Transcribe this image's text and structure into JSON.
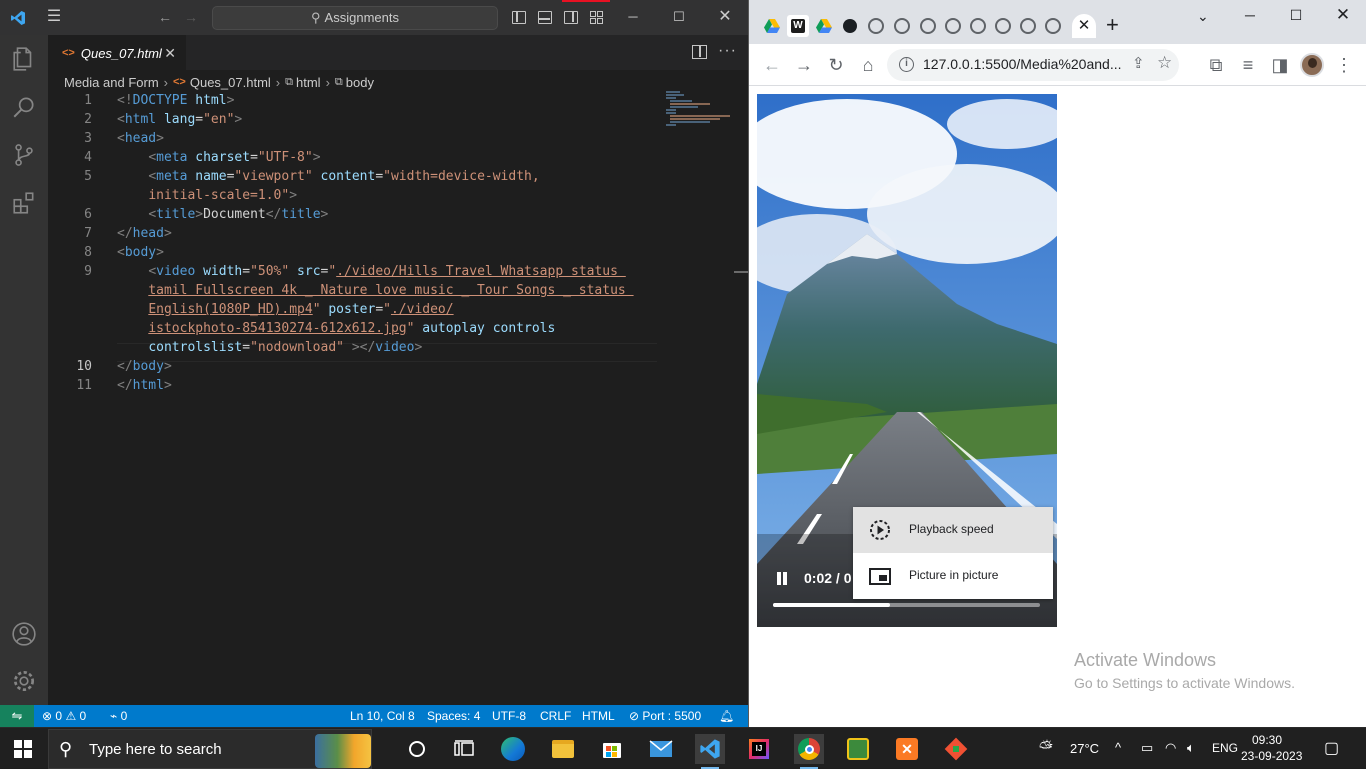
{
  "vscode": {
    "search_placeholder": "Assignments",
    "tab_label": "Ques_07.html",
    "tab_icon": "<>",
    "breadcrumb": [
      "Media and Form",
      "Ques_07.html",
      "html",
      "body"
    ],
    "code_lines": [
      {
        "n": "1",
        "html": "<span class='br'>&lt;!</span><span class='tg'>DOCTYPE</span> <span class='at'>html</span><span class='br'>&gt;</span>"
      },
      {
        "n": "2",
        "html": "<span class='br'>&lt;</span><span class='tg'>html</span> <span class='at'>lang</span><span class='tx'>=</span><span class='st'>\"en\"</span><span class='br'>&gt;</span>"
      },
      {
        "n": "3",
        "html": "<span class='br'>&lt;</span><span class='tg'>head</span><span class='br'>&gt;</span>"
      },
      {
        "n": "4",
        "html": "    <span class='br'>&lt;</span><span class='tg'>meta</span> <span class='at'>charset</span><span class='tx'>=</span><span class='st'>\"UTF-8\"</span><span class='br'>&gt;</span>"
      },
      {
        "n": "5",
        "html": "    <span class='br'>&lt;</span><span class='tg'>meta</span> <span class='at'>name</span><span class='tx'>=</span><span class='st'>\"viewport\"</span> <span class='at'>content</span><span class='tx'>=</span><span class='st'>\"width=device-width,</span>"
      },
      {
        "n": "",
        "html": "    <span class='st'>initial-scale=1.0\"</span><span class='br'>&gt;</span>"
      },
      {
        "n": "6",
        "html": "    <span class='br'>&lt;</span><span class='tg'>title</span><span class='br'>&gt;</span><span class='tx'>Document</span><span class='br'>&lt;/</span><span class='tg'>title</span><span class='br'>&gt;</span>"
      },
      {
        "n": "7",
        "html": "<span class='br'>&lt;/</span><span class='tg'>head</span><span class='br'>&gt;</span>"
      },
      {
        "n": "8",
        "html": "<span class='br'>&lt;</span><span class='tg'>body</span><span class='br'>&gt;</span>"
      },
      {
        "n": "9",
        "html": "    <span class='br'>&lt;</span><span class='tg'>video</span> <span class='at'>width</span><span class='tx'>=</span><span class='st'>\"50%\"</span> <span class='at'>src</span><span class='tx'>=</span><span class='st'>\"</span><span class='st u'>./video/Hills Travel Whatsapp status </span>"
      },
      {
        "n": "",
        "html": "    <span class='st u'>tamil Fullscreen 4k _ Nature love music _ Tour Songs _ status </span>"
      },
      {
        "n": "",
        "html": "    <span class='st u'>English(1080P_HD).mp4</span><span class='st'>\"</span> <span class='at'>poster</span><span class='tx'>=</span><span class='st'>\"</span><span class='st u'>./video/</span>"
      },
      {
        "n": "",
        "html": "    <span class='st u'>istockphoto-854130274-612x612.jpg</span><span class='st'>\"</span> <span class='at'>autoplay</span> <span class='at'>controls</span>"
      },
      {
        "n": "",
        "html": "    <span class='at'>controlslist</span><span class='tx'>=</span><span class='st'>\"nodownload\"</span> <span class='br'>&gt;&lt;/</span><span class='tg'>video</span><span class='br'>&gt;</span>"
      },
      {
        "n": "10",
        "html": "<span class='br'>&lt;/</span><span class='tg'>body</span><span class='br'>&gt;</span>"
      },
      {
        "n": "11",
        "html": "<span class='br'>&lt;/</span><span class='tg'>html</span><span class='br'>&gt;</span>"
      }
    ],
    "active_line": "10",
    "status": {
      "errors": "0",
      "warnings": "0",
      "ports": "0",
      "position": "Ln 10, Col 8",
      "spaces": "Spaces: 4",
      "encoding": "UTF-8",
      "eol": "CRLF",
      "language": "HTML",
      "port": "Port : 5500"
    }
  },
  "chrome": {
    "url": "127.0.0.1:5500/Media%20and...",
    "video": {
      "time": "0:02 / 0",
      "progress": 0.44
    },
    "video_menu": {
      "speed_label": "Playback speed",
      "pip_label": "Picture in picture"
    },
    "watermark": {
      "title": "Activate Windows",
      "subtitle": "Go to Settings to activate Windows."
    }
  },
  "taskbar": {
    "search_placeholder": "Type here to search",
    "weather": "27°C",
    "language": "ENG",
    "time": "09:30",
    "date": "23-09-2023"
  },
  "colors": {
    "vscode_bg": "#1e1e1e",
    "statusbar": "#007acc",
    "remote": "#16825d",
    "chrome_tabstrip": "#dee1e6"
  }
}
